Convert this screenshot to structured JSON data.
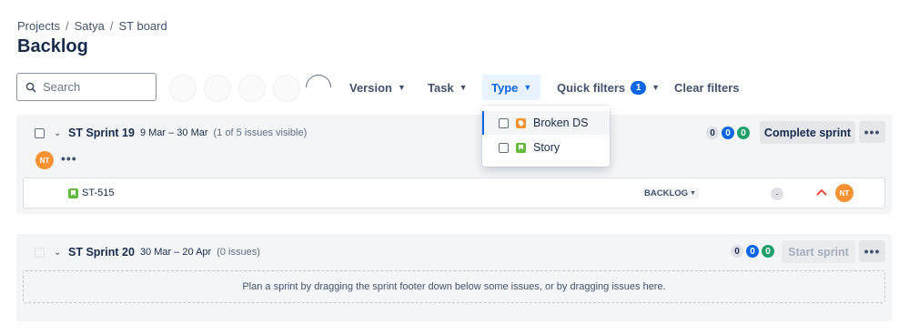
{
  "breadcrumb": [
    "Projects",
    "Satya",
    "ST board"
  ],
  "breadcrumb_sep": "/",
  "page_title": "Backlog",
  "search": {
    "placeholder": "Search"
  },
  "filters": {
    "version": "Version",
    "task": "Task",
    "type": "Type",
    "quick_filters": "Quick filters",
    "quick_filters_count": "1",
    "clear": "Clear filters"
  },
  "type_dropdown": {
    "options": [
      {
        "label": "Broken DS",
        "icon": "bug-icon",
        "checked": false
      },
      {
        "label": "Story",
        "icon": "story-icon",
        "checked": false
      }
    ]
  },
  "sprints": [
    {
      "name": "ST Sprint 19",
      "dates": "9 Mar – 30 Mar",
      "meta": "(1 of 5 issues visible)",
      "counts": [
        "0",
        "0",
        "0"
      ],
      "action": "Complete sprint",
      "assignee_initials": "NT",
      "more": "•••",
      "issues": [
        {
          "key": "ST-515",
          "status": "BACKLOG",
          "estimate": "-",
          "priority": "high-priority-icon",
          "assignee": "NT"
        }
      ]
    },
    {
      "name": "ST Sprint 20",
      "dates": "30 Mar – 20 Apr",
      "meta": "(0 issues)",
      "counts": [
        "0",
        "0",
        "0"
      ],
      "action": "Start sprint",
      "more": "•••",
      "empty_text": "Plan a sprint by dragging the sprint footer down below some issues, or by dragging issues here."
    }
  ],
  "colors": {
    "accent": "#0c66e4",
    "avatar": "#f79232",
    "done": "#22a06b",
    "story": "#63ba3c"
  }
}
